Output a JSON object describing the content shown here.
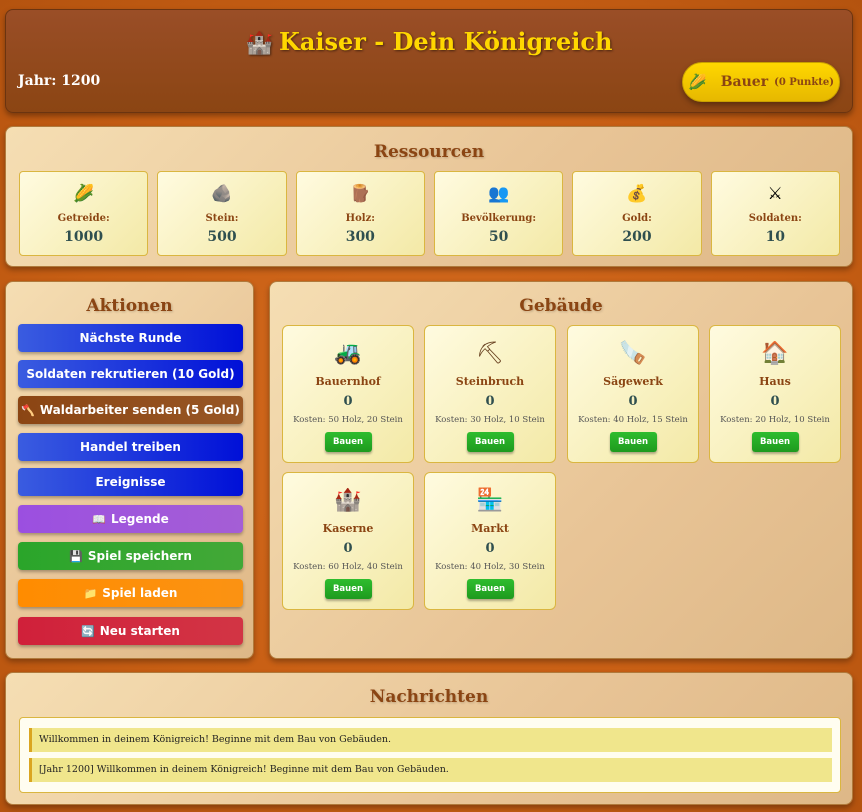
{
  "header": {
    "title_icon": "castle-icon",
    "title_icon_glyph": "🏰",
    "title": "Kaiser - Dein Königreich",
    "year_text": "Jahr: 1200",
    "rank": {
      "icon": "wheat-icon",
      "glyph": "🌽",
      "label": "Bauer",
      "points": "(0 Punkte)"
    }
  },
  "resources": {
    "title": "Ressourcen",
    "items": [
      {
        "icon": "wheat-icon",
        "glyph": "🌽",
        "label": "Getreide:",
        "value": "1000"
      },
      {
        "icon": "stone-icon",
        "glyph": "🪨",
        "label": "Stein:",
        "value": "500"
      },
      {
        "icon": "wood-icon",
        "glyph": "🪵",
        "label": "Holz:",
        "value": "300"
      },
      {
        "icon": "population-icon",
        "glyph": "👥",
        "label": "Bevölkerung:",
        "value": "50"
      },
      {
        "icon": "gold-bag-icon",
        "glyph": "💰",
        "label": "Gold:",
        "value": "200"
      },
      {
        "icon": "swords-icon",
        "glyph": "⚔",
        "label": "Soldaten:",
        "value": "10"
      }
    ]
  },
  "actions": {
    "title": "Aktionen",
    "buttons": [
      {
        "label": "Nächste Runde",
        "icon": "",
        "color": "#2a4fd8"
      },
      {
        "label": "Soldaten rekrutieren (10 Gold)",
        "icon": "",
        "color": "#2a4fd8"
      },
      {
        "label": "Waldarbeiter senden (5 Gold)",
        "icon": "🪓",
        "color": "#8b4513"
      },
      {
        "label": "Handel treiben",
        "icon": "",
        "color": "#2a4fd8"
      },
      {
        "label": "Ereignisse",
        "icon": "",
        "color": "#2a4fd8"
      },
      {
        "label": "Legende",
        "icon": "📖",
        "color": "#9b4fe0"
      },
      {
        "label": "Spiel speichern",
        "icon": "💾",
        "color": "#2aa52a"
      },
      {
        "label": "Spiel laden",
        "icon": "📁",
        "color": "#ff8c00"
      },
      {
        "label": "Neu starten",
        "icon": "🔄",
        "color": "#d0203a"
      }
    ]
  },
  "buildings": {
    "title": "Gebäude",
    "build_label": "Bauen",
    "items": [
      {
        "icon": "tractor-icon",
        "glyph": "🚜",
        "name": "Bauernhof",
        "count": "0",
        "cost": "Kosten: 50 Holz, 20 Stein"
      },
      {
        "icon": "pickaxe-icon",
        "glyph": "⛏",
        "name": "Steinbruch",
        "count": "0",
        "cost": "Kosten: 30 Holz, 10 Stein"
      },
      {
        "icon": "saw-icon",
        "glyph": "🪚",
        "name": "Sägewerk",
        "count": "0",
        "cost": "Kosten: 40 Holz, 15 Stein"
      },
      {
        "icon": "house-icon",
        "glyph": "🏠",
        "name": "Haus",
        "count": "0",
        "cost": "Kosten: 20 Holz, 10 Stein"
      },
      {
        "icon": "castle-icon",
        "glyph": "🏰",
        "name": "Kaserne",
        "count": "0",
        "cost": "Kosten: 60 Holz, 40 Stein"
      },
      {
        "icon": "market-icon",
        "glyph": "🏪",
        "name": "Markt",
        "count": "0",
        "cost": "Kosten: 40 Holz, 30 Stein"
      }
    ]
  },
  "messages": {
    "title": "Nachrichten",
    "items": [
      "Willkommen in deinem Königreich! Beginne mit dem Bau von Gebäuden.",
      "[Jahr 1200] Willkommen in deinem Königreich! Beginne mit dem Bau von Gebäuden."
    ]
  }
}
